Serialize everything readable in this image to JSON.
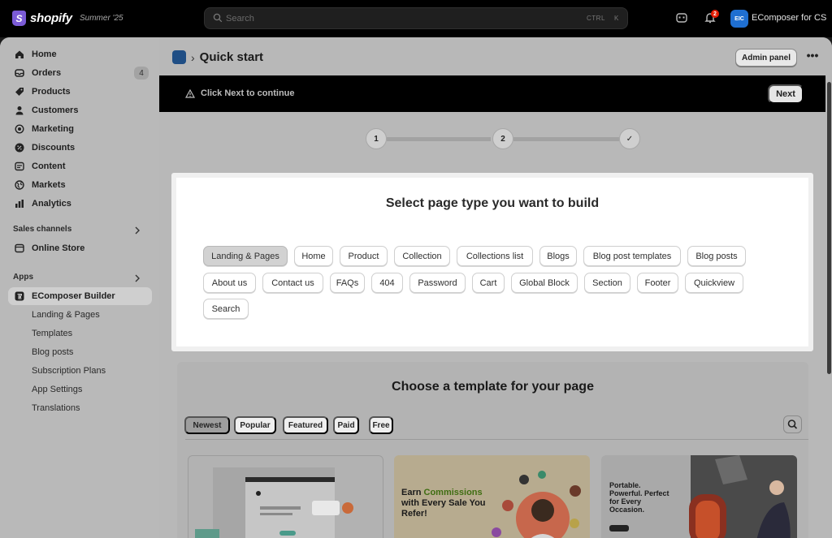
{
  "topbar": {
    "brand": "shopify",
    "brand_mark": "S",
    "edition": "Summer '25",
    "search_placeholder": "Search",
    "shortcut_ctrl": "CTRL",
    "shortcut_key": "K",
    "notification_count": "2",
    "store_initials": "EIC",
    "store_name": "EComposer for CS"
  },
  "sidebar": {
    "items": [
      {
        "label": "Home",
        "icon": "home-icon"
      },
      {
        "label": "Orders",
        "icon": "orders-icon",
        "count": "4"
      },
      {
        "label": "Products",
        "icon": "tag-icon"
      },
      {
        "label": "Customers",
        "icon": "person-icon"
      },
      {
        "label": "Marketing",
        "icon": "target-icon"
      },
      {
        "label": "Discounts",
        "icon": "discount-icon"
      },
      {
        "label": "Content",
        "icon": "content-icon"
      },
      {
        "label": "Markets",
        "icon": "globe-icon"
      },
      {
        "label": "Analytics",
        "icon": "chart-icon"
      }
    ],
    "sales_channels_label": "Sales channels",
    "online_store_label": "Online Store",
    "apps_label": "Apps",
    "app_name": "EComposer Builder",
    "app_subitems": [
      "Landing & Pages",
      "Templates",
      "Blog posts",
      "Subscription Plans",
      "App Settings",
      "Translations"
    ]
  },
  "main": {
    "breadcrumb_sep": "›",
    "title": "Quick start",
    "admin_button": "Admin panel",
    "more": "•••",
    "banner_message": "Click Next to continue",
    "next_button": "Next",
    "steps": [
      "1",
      "2",
      "✓"
    ],
    "select_title": "Select page type you want to build",
    "page_types": [
      "Landing & Pages",
      "Home",
      "Product",
      "Collection",
      "Collections list",
      "Blogs",
      "Blog post templates",
      "Blog posts",
      "About us",
      "Contact us",
      "FAQs",
      "404",
      "Password",
      "Cart",
      "Global Block",
      "Section",
      "Footer",
      "Quickview",
      "Search"
    ],
    "selected_page_type": "Landing & Pages",
    "template_title": "Choose a template for your page",
    "template_tabs": [
      "Newest",
      "Popular",
      "Featured",
      "Paid",
      "Free"
    ],
    "active_tab": "Newest",
    "thumb2_heading_a": "Earn ",
    "thumb2_heading_b": "Commissions",
    "thumb2_heading_c": " with Every Sale You Refer!",
    "thumb3_heading": "Portable. Powerful. Perfect for Every Occasion."
  },
  "colors": {
    "topbar_bg": "#000000",
    "brand_purple": "#7b5bd6",
    "avatar_blue": "#1f6fd1",
    "notification_red": "#e51c00",
    "accent_green": "#3f6d12"
  }
}
